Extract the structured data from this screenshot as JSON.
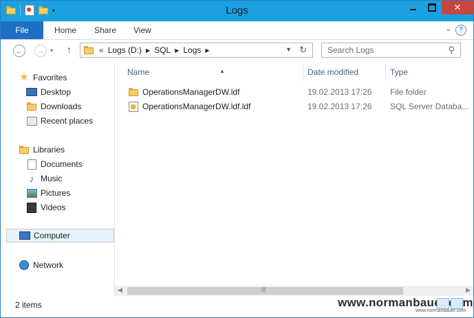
{
  "window": {
    "title": "Logs"
  },
  "ribbon": {
    "file": "File",
    "tabs": [
      "Home",
      "Share",
      "View"
    ],
    "help": "?"
  },
  "address": {
    "overflow": "«",
    "crumbs": [
      "Logs (D:)",
      "SQL",
      "Logs"
    ]
  },
  "search": {
    "placeholder": "Search Logs"
  },
  "nav": {
    "favorites": "Favorites",
    "favorite_items": [
      "Desktop",
      "Downloads",
      "Recent places"
    ],
    "libraries": "Libraries",
    "library_items": [
      "Documents",
      "Music",
      "Pictures",
      "Videos"
    ],
    "computer": "Computer",
    "network": "Network"
  },
  "columns": [
    "Name",
    "Date modified",
    "Type"
  ],
  "files": [
    {
      "name": "OperationsManagerDW.ldf",
      "date": "19.02.2013 17:26",
      "type": "File folder",
      "icon": "folder-icon"
    },
    {
      "name": "OperationsManagerDW.ldf.ldf",
      "date": "19.02.2013 17:26",
      "type": "SQL Server Databa...",
      "icon": "sql-database-file-icon"
    }
  ],
  "status": {
    "count": "2 items"
  },
  "watermark": {
    "main": "www.normanbauer.com",
    "small": "www.normanbauer.com"
  },
  "colors": {
    "titlebar": "#1aa1e1",
    "file_tab": "#1f6fc5",
    "close": "#c7463d",
    "selection": "#e5f3fb"
  }
}
